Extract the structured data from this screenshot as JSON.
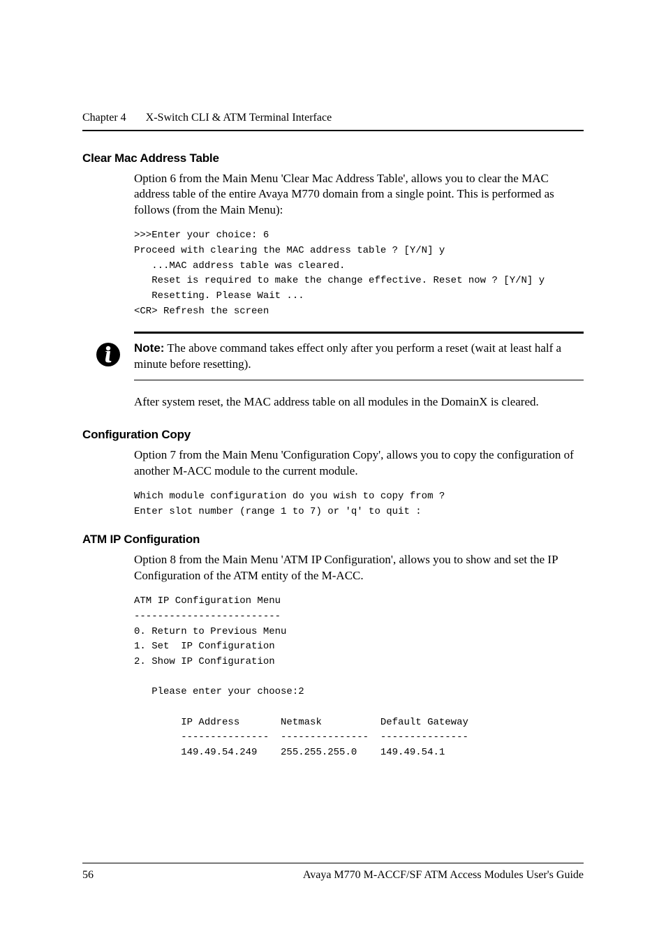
{
  "runningHead": {
    "chapter": "Chapter 4",
    "title": "X-Switch CLI & ATM Terminal Interface"
  },
  "sectionClear": {
    "heading": "Clear Mac Address Table",
    "para": "Option 6 from the Main Menu 'Clear Mac Address Table', allows you to clear the MAC address table of the entire Avaya M770 domain from a single point. This is performed as follows (from the Main Menu):",
    "code": ">>>Enter your choice: 6\nProceed with clearing the MAC address table ? [Y/N] y\n   ...MAC address table was cleared.\n   Reset is required to make the change effective. Reset now ? [Y/N] y\n   Resetting. Please Wait ...\n<CR> Refresh the screen"
  },
  "note": {
    "label": "Note:",
    "text": "The above command takes effect only after you perform a reset (wait at least half a minute before resetting)."
  },
  "afterNotePara": "After system reset, the MAC address table on all modules in the DomainX is cleared.",
  "sectionCopy": {
    "heading": "Configuration Copy",
    "para": "Option 7 from the Main Menu 'Configuration Copy', allows you to copy the configuration of another M-ACC module to the current module.",
    "code": "Which module configuration do you wish to copy from ?\nEnter slot number (range 1 to 7) or 'q' to quit :"
  },
  "sectionAtm": {
    "heading": "ATM IP Configuration",
    "para": "Option 8 from the Main Menu 'ATM IP Configuration', allows you to show and set the IP Configuration of the ATM entity of the M-ACC.",
    "code": "ATM IP Configuration Menu\n-------------------------\n0. Return to Previous Menu\n1. Set  IP Configuration\n2. Show IP Configuration\n\n   Please enter your choose:2\n\n        IP Address       Netmask          Default Gateway\n        ---------------  ---------------  ---------------\n        149.49.54.249    255.255.255.0    149.49.54.1"
  },
  "footer": {
    "pageNumber": "56",
    "guide": "Avaya M770 M-ACCF/SF ATM Access Modules User's Guide"
  }
}
